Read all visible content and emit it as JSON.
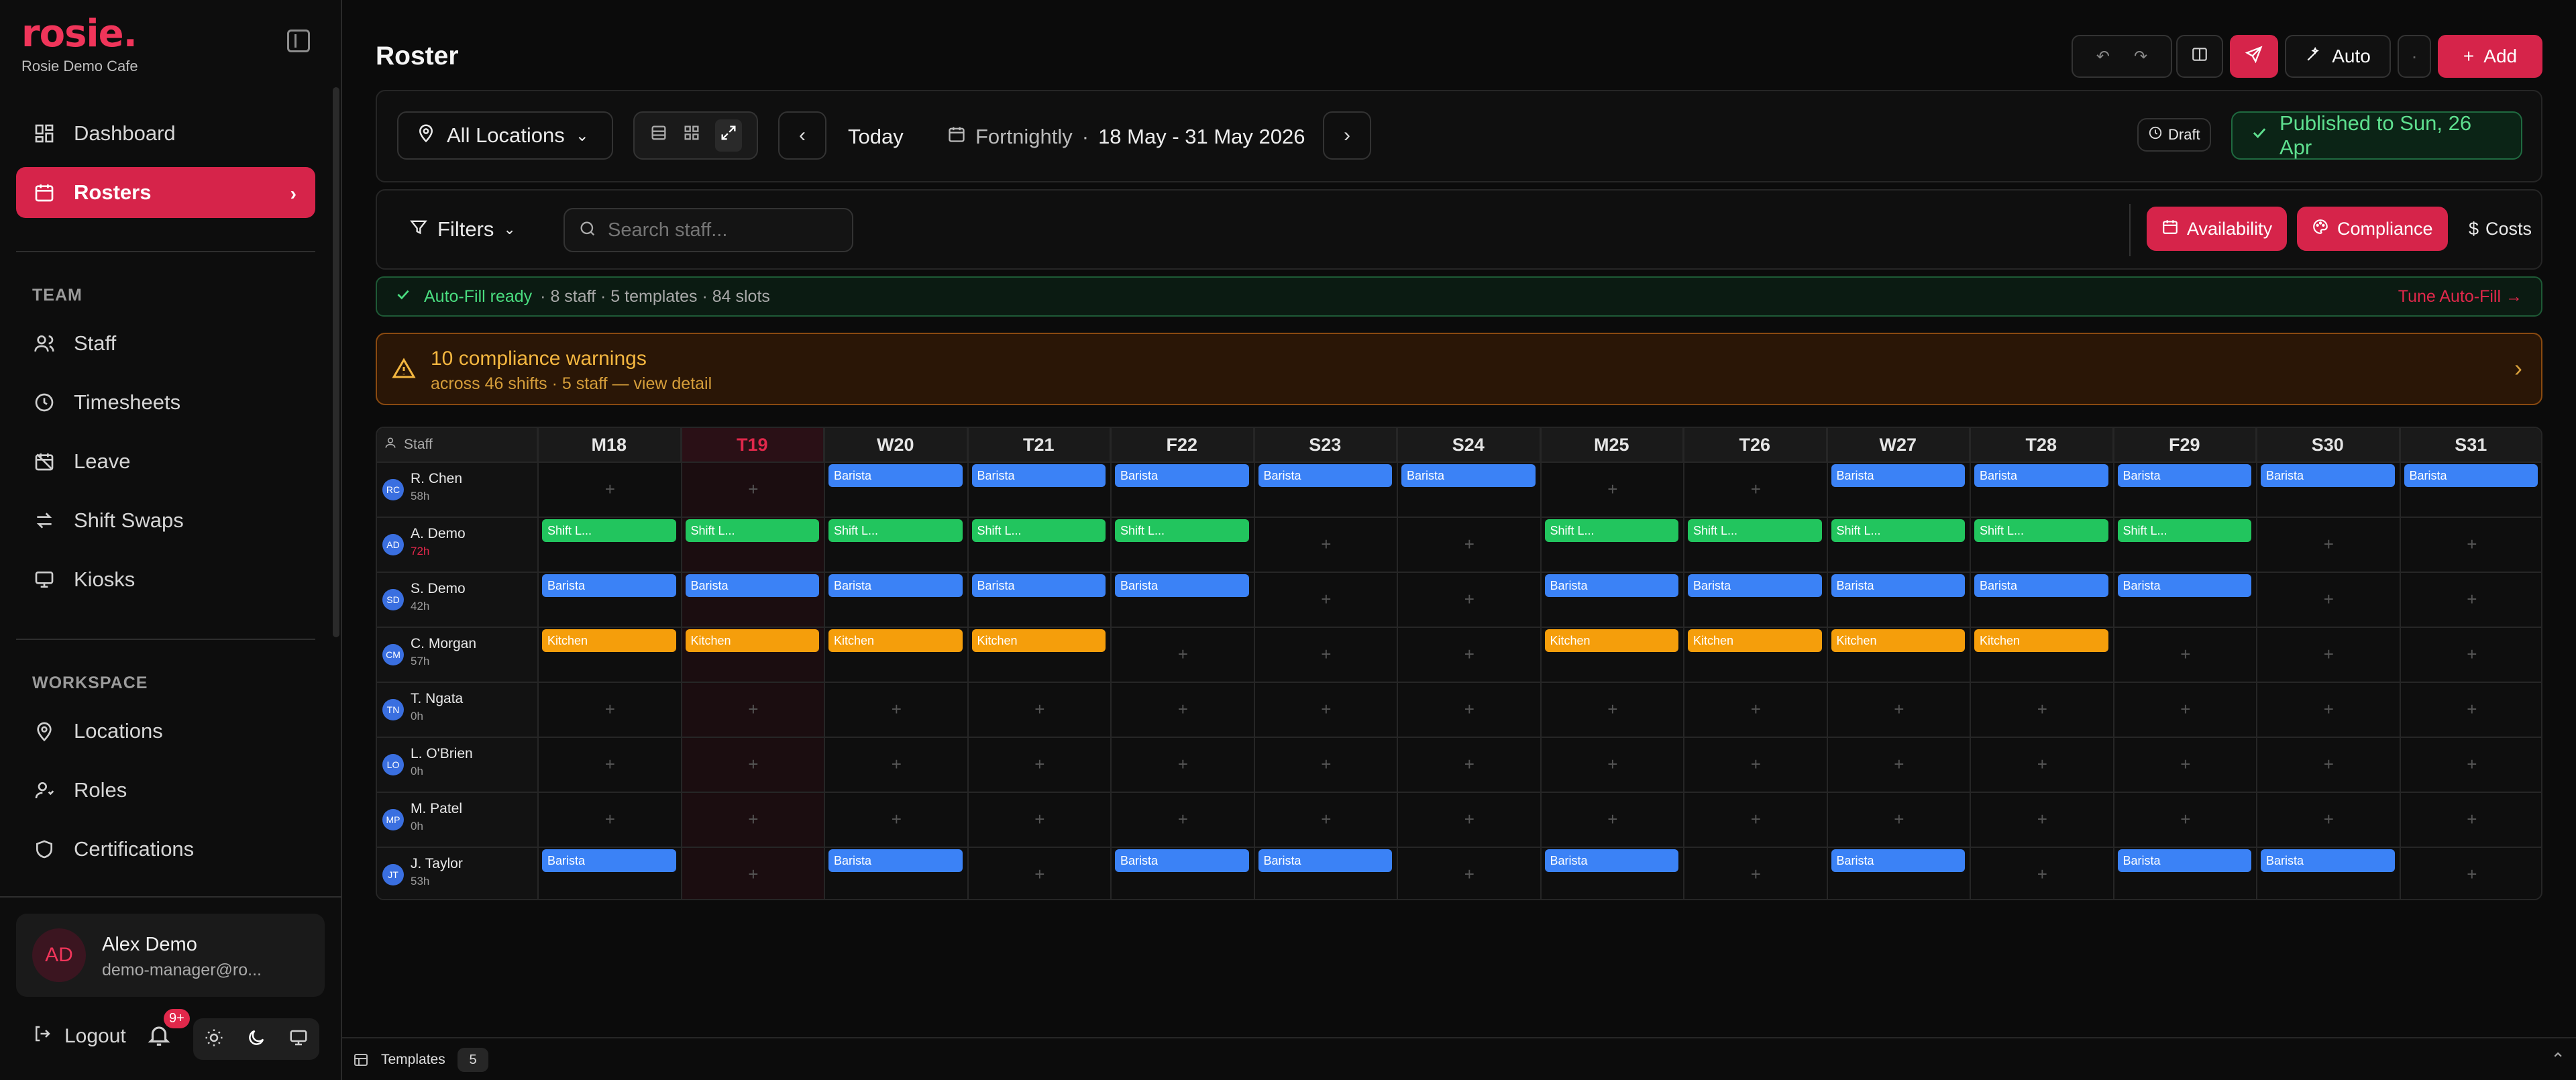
{
  "colors": {
    "accent": "#d6244a",
    "barista": "#3b82f6",
    "shift": "#22c55e",
    "kitchen": "#f59e0b",
    "success": "#34d399",
    "warning": "#f4b740"
  },
  "sidebar": {
    "logo": "rosie.",
    "org": "Rosie Demo Cafe",
    "nav": [
      {
        "label": "Dashboard",
        "icon": "dashboard-icon"
      },
      {
        "label": "Rosters",
        "icon": "calendar-icon"
      }
    ],
    "team_title": "TEAM",
    "team": [
      {
        "label": "Staff",
        "icon": "users-icon"
      },
      {
        "label": "Timesheets",
        "icon": "clock-icon"
      },
      {
        "label": "Leave",
        "icon": "calendar-off-icon"
      },
      {
        "label": "Shift Swaps",
        "icon": "swap-icon"
      },
      {
        "label": "Kiosks",
        "icon": "monitor-icon"
      }
    ],
    "workspace_title": "WORKSPACE",
    "workspace": [
      {
        "label": "Locations",
        "icon": "map-pin-icon"
      },
      {
        "label": "Roles",
        "icon": "user-role-icon"
      },
      {
        "label": "Certifications",
        "icon": "shield-icon"
      }
    ],
    "user": {
      "initials": "AD",
      "name": "Alex Demo",
      "email": "demo-manager@ro..."
    },
    "logout": "Logout",
    "notifications": "9+"
  },
  "header": {
    "title": "Roster",
    "auto": "Auto",
    "add": "Add"
  },
  "toolbar": {
    "location": "All Locations",
    "today": "Today",
    "period": "Fortnightly",
    "separator": "·",
    "range": "18 May - 31 May 2026",
    "draft": "Draft",
    "published": "Published to Sun, 26 Apr"
  },
  "filters": {
    "label": "Filters",
    "search_placeholder": "Search staff...",
    "availability": "Availability",
    "compliance": "Compliance",
    "costs": "Costs"
  },
  "autofill": {
    "ready": "Auto-Fill ready",
    "detail": "· 8 staff · 5 templates · 84 slots",
    "tune": "Tune Auto-Fill →"
  },
  "compliance": {
    "title": "10 compliance warnings",
    "detail": "across 46 shifts · 5 staff — view detail"
  },
  "roster": {
    "staff_header": "Staff",
    "days": [
      "M18",
      "T19",
      "W20",
      "T21",
      "F22",
      "S23",
      "S24",
      "M25",
      "T26",
      "W27",
      "T28",
      "F29",
      "S30",
      "S31"
    ],
    "today_index": 1,
    "staff": [
      {
        "initials": "RC",
        "name": "R. Chen",
        "hours": "58h",
        "over": false,
        "shifts": [
          null,
          null,
          "Barista",
          "Barista",
          "Barista",
          "Barista",
          "Barista",
          null,
          null,
          "Barista",
          "Barista",
          "Barista",
          "Barista",
          "Barista"
        ]
      },
      {
        "initials": "AD",
        "name": "A. Demo",
        "hours": "72h",
        "over": true,
        "shifts": [
          "Shift L...",
          "Shift L...",
          "Shift L...",
          "Shift L...",
          "Shift L...",
          null,
          null,
          "Shift L...",
          "Shift L...",
          "Shift L...",
          "Shift L...",
          "Shift L...",
          null,
          null
        ]
      },
      {
        "initials": "SD",
        "name": "S. Demo",
        "hours": "42h",
        "over": false,
        "shifts": [
          "Barista",
          "Barista",
          "Barista",
          "Barista",
          "Barista",
          null,
          null,
          "Barista",
          "Barista",
          "Barista",
          "Barista",
          "Barista",
          null,
          null
        ]
      },
      {
        "initials": "CM",
        "name": "C. Morgan",
        "hours": "57h",
        "over": false,
        "shifts": [
          "Kitchen",
          "Kitchen",
          "Kitchen",
          "Kitchen",
          null,
          null,
          null,
          "Kitchen",
          "Kitchen",
          "Kitchen",
          "Kitchen",
          null,
          null,
          null
        ]
      },
      {
        "initials": "TN",
        "name": "T. Ngata",
        "hours": "0h",
        "over": false,
        "shifts": [
          null,
          null,
          null,
          null,
          null,
          null,
          null,
          null,
          null,
          null,
          null,
          null,
          null,
          null
        ]
      },
      {
        "initials": "LO",
        "name": "L. O'Brien",
        "hours": "0h",
        "over": false,
        "shifts": [
          null,
          null,
          null,
          null,
          null,
          null,
          null,
          null,
          null,
          null,
          null,
          null,
          null,
          null
        ]
      },
      {
        "initials": "MP",
        "name": "M. Patel",
        "hours": "0h",
        "over": false,
        "shifts": [
          null,
          null,
          null,
          null,
          null,
          null,
          null,
          null,
          null,
          null,
          null,
          null,
          null,
          null
        ]
      },
      {
        "initials": "JT",
        "name": "J. Taylor",
        "hours": "53h",
        "over": false,
        "shifts": [
          "Barista",
          null,
          "Barista",
          null,
          "Barista",
          "Barista",
          null,
          "Barista",
          null,
          "Barista",
          null,
          "Barista",
          "Barista",
          null
        ]
      }
    ]
  },
  "bottom": {
    "templates": "Templates",
    "count": "5"
  }
}
